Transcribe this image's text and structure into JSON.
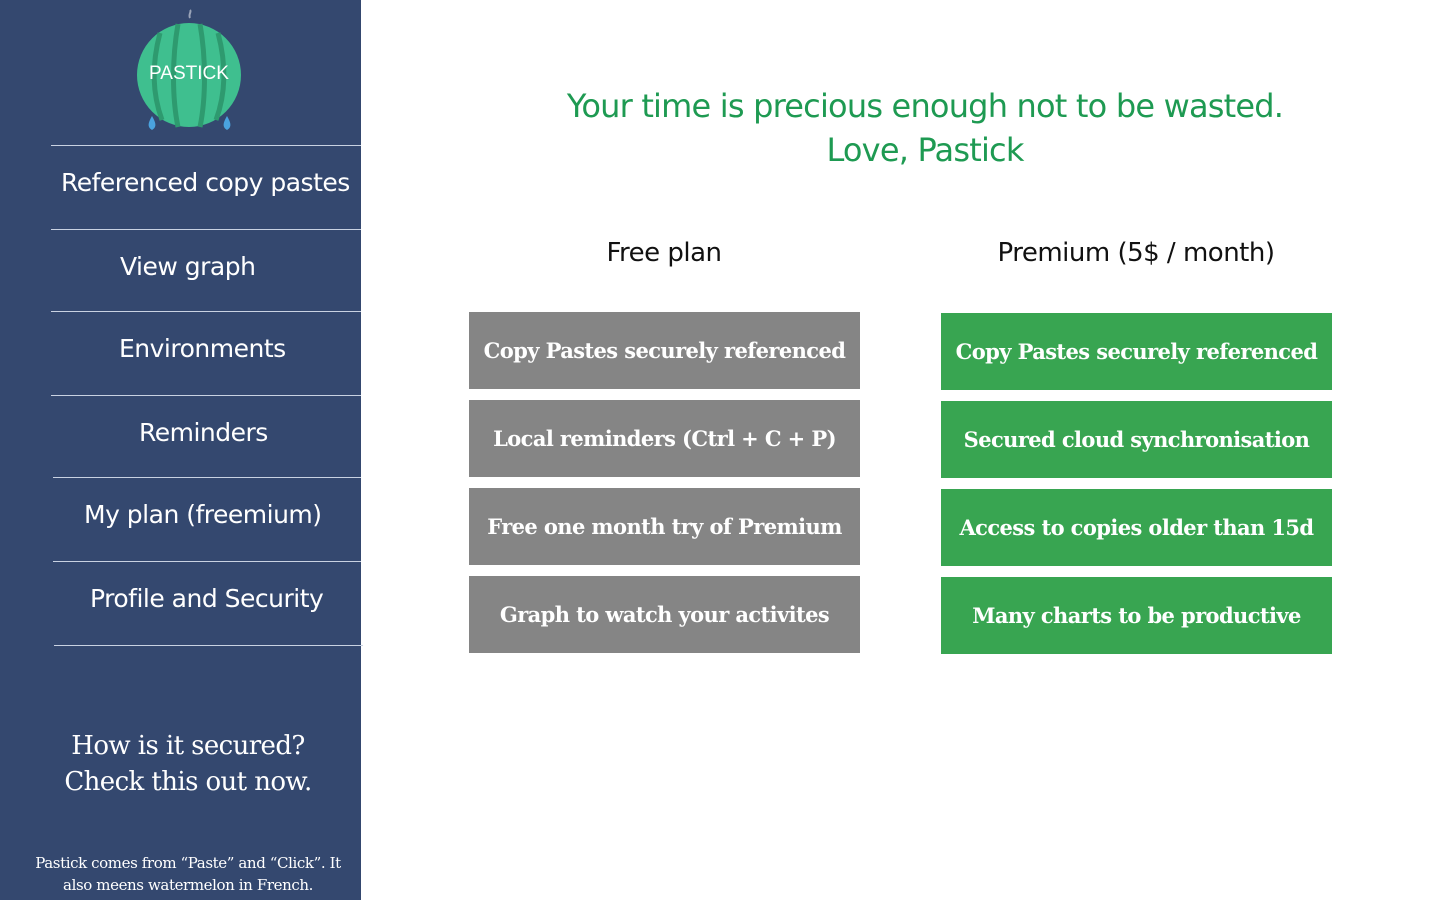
{
  "app": {
    "logo_text": "PASTICK"
  },
  "sidebar": {
    "items": [
      {
        "label": "Referenced copy pastes"
      },
      {
        "label": "View graph"
      },
      {
        "label": "Environments"
      },
      {
        "label": "Reminders"
      },
      {
        "label": "My plan (freemium)"
      },
      {
        "label": "Profile and Security"
      }
    ],
    "promo_line1": "How is it secured?",
    "promo_line2": "Check this out now.",
    "footnote_line1": "Pastick comes from “Paste” and “Click”. It",
    "footnote_line2": "also meens watermelon in French."
  },
  "main": {
    "tagline_line1": "Your time is precious enough not to be wasted.",
    "tagline_line2": "Love, Pastick",
    "free_plan": {
      "title": "Free plan",
      "features": [
        "Copy Pastes securely referenced",
        "Local reminders (Ctrl + C + P)",
        "Free one month try of Premium",
        "Graph to watch your activites"
      ]
    },
    "premium_plan": {
      "title": "Premium (5$ / month)",
      "features": [
        "Copy Pastes securely referenced",
        "Secured cloud synchronisation",
        "Access to copies older than 15d",
        "Many charts to be productive"
      ]
    }
  },
  "colors": {
    "sidebar_bg": "#34486f",
    "accent_green": "#1e9a52",
    "premium_green": "#38a551",
    "free_gray": "#858585"
  }
}
